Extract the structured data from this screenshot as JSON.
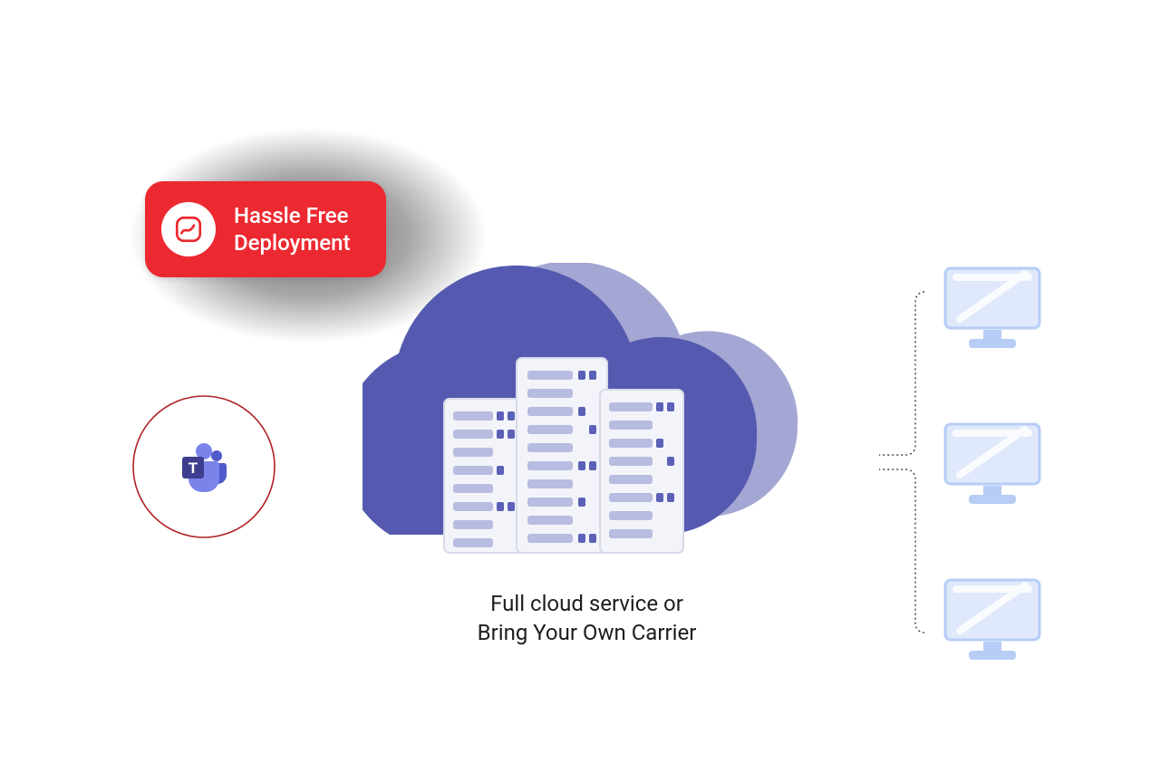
{
  "badge": {
    "line1": "Hassle Free",
    "line2": "Deployment"
  },
  "caption": {
    "line1": "Full cloud service or",
    "line2": "Bring Your Own Carrier"
  },
  "teams": {
    "letter": "T"
  },
  "colors": {
    "badge_bg": "#ec2931",
    "cloud_front": "#555ab0",
    "cloud_back": "#a4a7d3",
    "teams_purple": "#5059c9",
    "teams_dark": "#3d3e8f",
    "monitor_fill": "#dfe9fb",
    "monitor_base": "#b7cdf6",
    "ring_red": "#b02027"
  }
}
